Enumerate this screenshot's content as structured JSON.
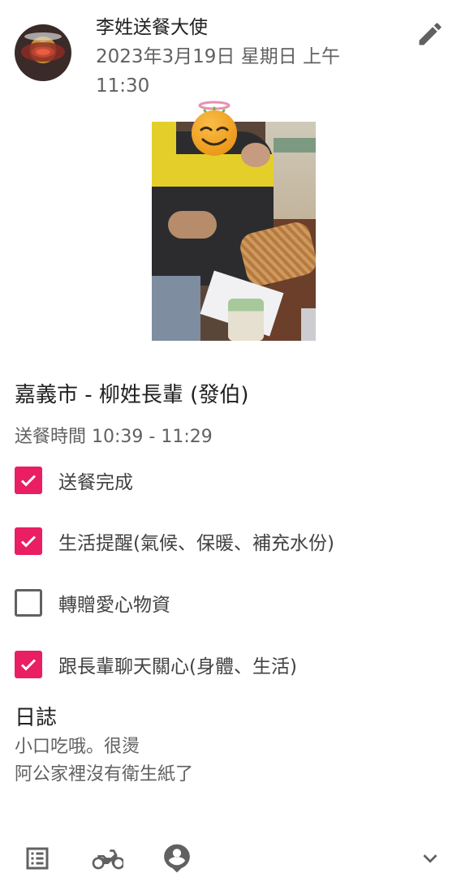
{
  "header": {
    "author": "李姓送餐大使",
    "datetime": "2023年3月19日 星期日 上午 11:30",
    "edit_icon": "pencil-icon"
  },
  "post": {
    "title": "嘉義市 - 柳姓長輩 (發伯)",
    "time_range": "送餐時間 10:39 - 11:29"
  },
  "checklist": [
    {
      "label": "送餐完成",
      "checked": true
    },
    {
      "label": "生活提醒(氣候、保暖、補充水份)",
      "checked": true
    },
    {
      "label": "轉贈愛心物資",
      "checked": false
    },
    {
      "label": "跟長輩聊天關心(身體、生活)",
      "checked": true
    }
  ],
  "log": {
    "title": "日誌",
    "lines": [
      "小口吃哦。很燙",
      "阿公家裡沒有衛生紙了"
    ]
  },
  "bottom_bar": {
    "icons": [
      "list-icon",
      "motorcycle-icon",
      "location-person-icon",
      "chevron-down-icon"
    ]
  },
  "colors": {
    "accent": "#e91e63",
    "text_primary": "#212121",
    "text_secondary": "#616161"
  }
}
